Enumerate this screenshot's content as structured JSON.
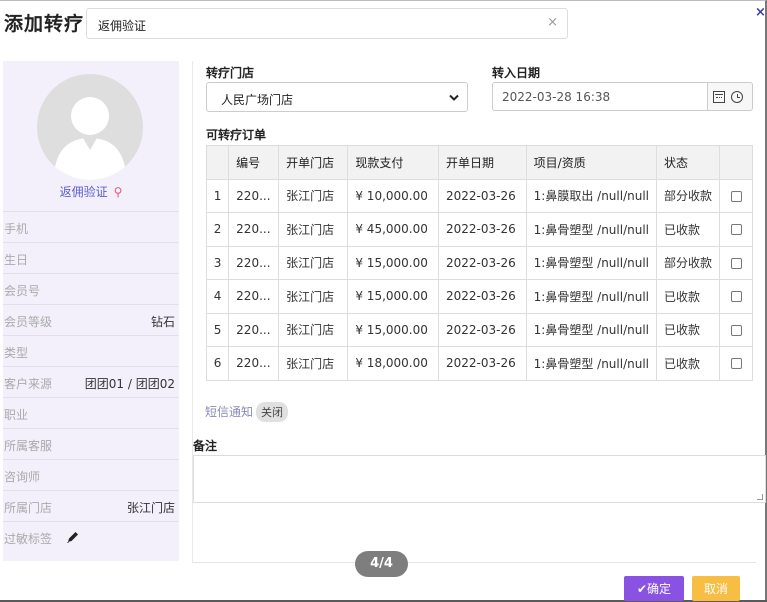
{
  "modal": {
    "title": "添加转疗",
    "tab_label": "返佣验证",
    "tab_close": "×",
    "close": "×"
  },
  "customer": {
    "verify_label": "返佣验证",
    "fields": [
      {
        "label": "手机",
        "value": ""
      },
      {
        "label": "生日",
        "value": ""
      },
      {
        "label": "会员号",
        "value": ""
      },
      {
        "label": "会员等级",
        "value": "钻石"
      },
      {
        "label": "类型",
        "value": ""
      },
      {
        "label": "客户来源",
        "value": "团团01 / 团团02"
      },
      {
        "label": "职业",
        "value": ""
      },
      {
        "label": "所属客服",
        "value": ""
      },
      {
        "label": "咨询师",
        "value": ""
      },
      {
        "label": "所属门店",
        "value": "张江门店"
      },
      {
        "label": "过敏标签",
        "value": ""
      }
    ]
  },
  "form": {
    "store_label": "转疗门店",
    "store_value": "人民广场门店",
    "date_label": "转入日期",
    "date_value": "2022-03-28 16:38",
    "orders_label": "可转疗订单",
    "sms_label": "短信通知",
    "sms_state": "关闭",
    "remark_label": "备注"
  },
  "orders": {
    "headers": [
      "",
      "编号",
      "开单门店",
      "现款支付",
      "开单日期",
      "项目/资质",
      "状态",
      ""
    ],
    "rows": [
      {
        "idx": "1",
        "id": "220...",
        "store": "张江门店",
        "pay": "¥ 10,000.00",
        "date": "2022-03-26",
        "item": "1:鼻膜取出 /null/null",
        "status": "部分收款"
      },
      {
        "idx": "2",
        "id": "220...",
        "store": "张江门店",
        "pay": "¥ 45,000.00",
        "date": "2022-03-26",
        "item": "1:鼻骨塑型 /null/null",
        "status": "已收款"
      },
      {
        "idx": "3",
        "id": "220...",
        "store": "张江门店",
        "pay": "¥ 15,000.00",
        "date": "2022-03-26",
        "item": "1:鼻骨塑型 /null/null",
        "status": "部分收款"
      },
      {
        "idx": "4",
        "id": "220...",
        "store": "张江门店",
        "pay": "¥ 15,000.00",
        "date": "2022-03-26",
        "item": "1:鼻骨塑型 /null/null",
        "status": "已收款"
      },
      {
        "idx": "5",
        "id": "220...",
        "store": "张江门店",
        "pay": "¥ 15,000.00",
        "date": "2022-03-26",
        "item": "1:鼻骨塑型 /null/null",
        "status": "已收款"
      },
      {
        "idx": "6",
        "id": "220...",
        "store": "张江门店",
        "pay": "¥ 18,000.00",
        "date": "2022-03-26",
        "item": "1:鼻骨塑型 /null/null",
        "status": "已收款"
      }
    ]
  },
  "footer": {
    "pager": "4/4",
    "confirm": "✔确定",
    "cancel": "取消"
  },
  "colors": {
    "accent": "#8a52e2",
    "cancel": "#f8bd43",
    "link": "#5a5ccc",
    "panel_bg": "#f3f0fb"
  },
  "icons": {
    "verify": "key-icon",
    "allergy": "pencil-icon",
    "date": "calendar-icon",
    "time": "clock-icon"
  }
}
